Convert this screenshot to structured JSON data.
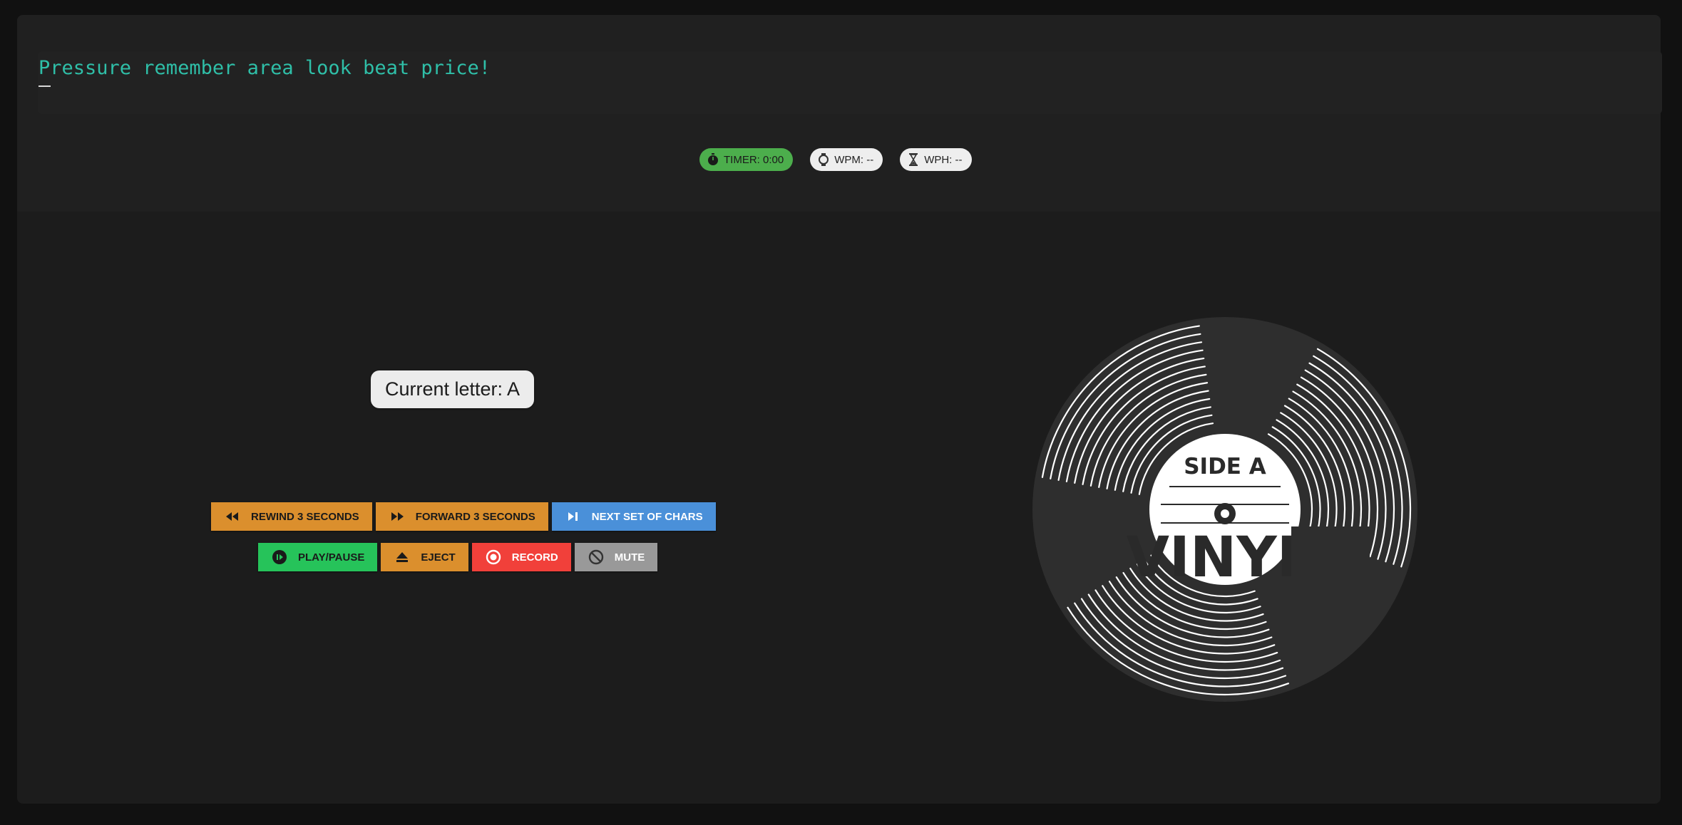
{
  "sentence": "Pressure remember area look beat price!",
  "stats": {
    "timer": "TIMER: 0:00",
    "wpm": "WPM: --",
    "wph": "WPH: --"
  },
  "current_letter": "Current letter: A",
  "controls": {
    "rewind": "REWIND 3 SECONDS",
    "forward": "FORWARD 3 SECONDS",
    "next": "NEXT SET OF CHARS",
    "play_pause": "PLAY/PAUSE",
    "eject": "EJECT",
    "record": "RECORD",
    "mute": "MUTE"
  },
  "record_label": {
    "side": "SIDE A",
    "name": "VINYL"
  },
  "colors": {
    "sentence_text": "#2fbfa8",
    "timer": "#4cae4c",
    "orange": "#db8f2d",
    "blue": "#4a90d9",
    "green": "#26c35a",
    "red": "#f1403a",
    "gray": "#999999"
  },
  "icons": {
    "timer": "stopwatch-icon",
    "wpm": "watch-icon",
    "wph": "hourglass-icon",
    "rewind": "rewind-icon",
    "forward": "fast-forward-icon",
    "next": "skip-next-icon",
    "play_pause": "play-pause-icon",
    "eject": "eject-icon",
    "record": "record-icon",
    "mute": "mute-icon"
  }
}
